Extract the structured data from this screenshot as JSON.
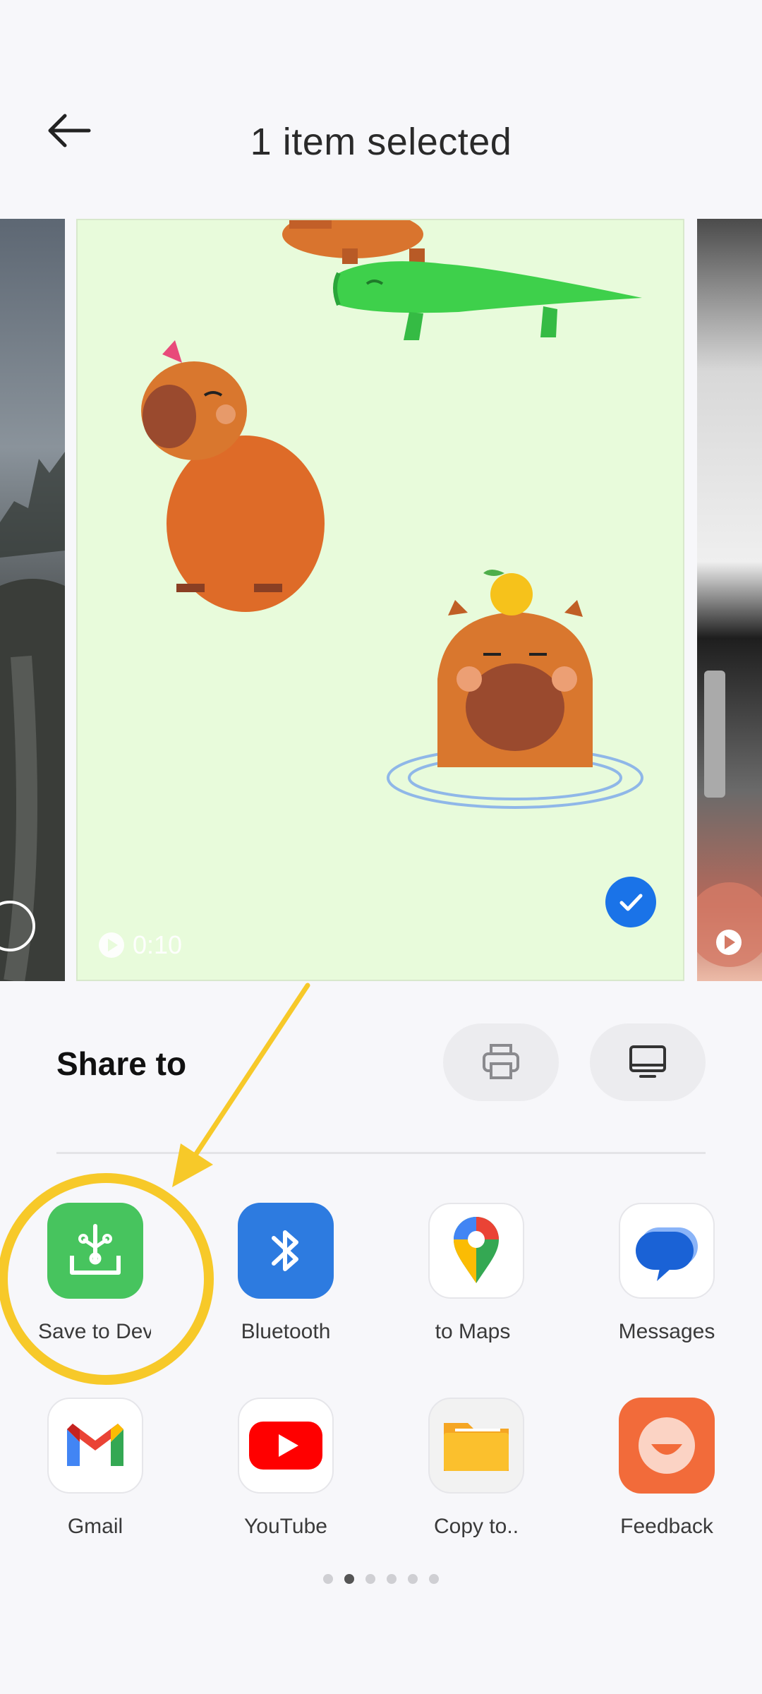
{
  "header": {
    "title": "1 item selected",
    "back_icon": "arrow-left-icon"
  },
  "media": {
    "duration": "0:10",
    "selected": true,
    "accent": "#1a73e8",
    "main_background": "#e8fbdb"
  },
  "share": {
    "title": "Share to",
    "print_icon": "print-icon",
    "cast_icon": "monitor-icon"
  },
  "apps": [
    {
      "label": "Save to Dev",
      "icon": "download-tray-icon",
      "color": "#47c45e"
    },
    {
      "label": "Bluetooth",
      "icon": "bluetooth-icon",
      "color": "#2d7be0"
    },
    {
      "label": "to Maps",
      "icon": "maps-pin-icon",
      "color": "#ffffff"
    },
    {
      "label": "Messages",
      "icon": "messages-bubble-icon",
      "color": "#ffffff"
    },
    {
      "label": "Gmail",
      "icon": "gmail-icon",
      "color": "#ffffff"
    },
    {
      "label": "YouTube",
      "icon": "youtube-icon",
      "color": "#ffffff"
    },
    {
      "label": "Copy to..",
      "icon": "folder-icon",
      "color": "#f2f2f2"
    },
    {
      "label": "Feedback",
      "icon": "feedback-smile-icon",
      "color": "#f26b3a"
    }
  ],
  "pager": {
    "pages": 6,
    "current": 2
  },
  "annotation_color": "#f7c929"
}
